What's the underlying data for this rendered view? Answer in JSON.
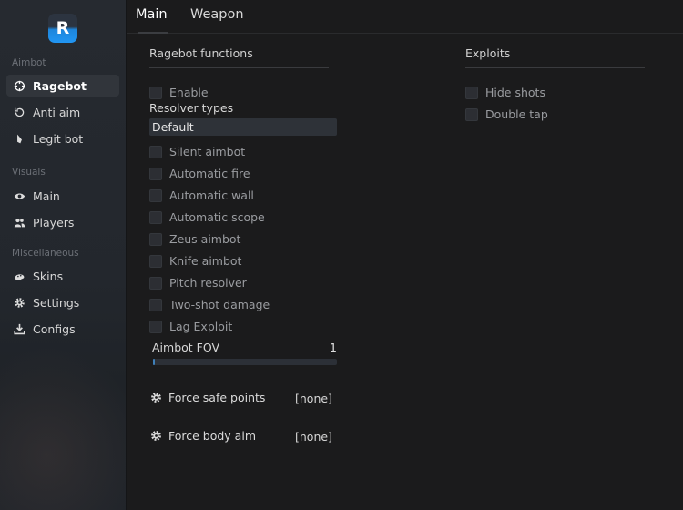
{
  "logo": {
    "letter": "R"
  },
  "sidebar": {
    "sections": [
      "Aimbot",
      "Visuals",
      "Miscellaneous"
    ],
    "items": [
      {
        "label": "Ragebot"
      },
      {
        "label": "Anti aim"
      },
      {
        "label": "Legit bot"
      },
      {
        "label": "Main"
      },
      {
        "label": "Players"
      },
      {
        "label": "Skins"
      },
      {
        "label": "Settings"
      },
      {
        "label": "Configs"
      }
    ]
  },
  "tabs": [
    "Main",
    "Weapon"
  ],
  "ragebot": {
    "title": "Ragebot functions",
    "enable": "Enable",
    "resolver_label": "Resolver types",
    "resolver_value": "Default",
    "checkboxes": [
      "Silent aimbot",
      "Automatic fire",
      "Automatic wall",
      "Automatic scope",
      "Zeus aimbot",
      "Knife aimbot",
      "Pitch resolver",
      "Two-shot damage",
      "Lag Exploit"
    ],
    "fov_label": "Aimbot FOV",
    "fov_value": "1",
    "fov_fraction": 0.01,
    "binds": [
      {
        "label": "Force safe points",
        "key": "[none]"
      },
      {
        "label": "Force body aim",
        "key": "[none]"
      }
    ]
  },
  "exploits": {
    "title": "Exploits",
    "checkboxes": [
      "Hide shots",
      "Double tap"
    ]
  },
  "colors": {
    "accent": "#2196f3",
    "active_nav": "#31353b",
    "panel": "#1b1b1c"
  }
}
